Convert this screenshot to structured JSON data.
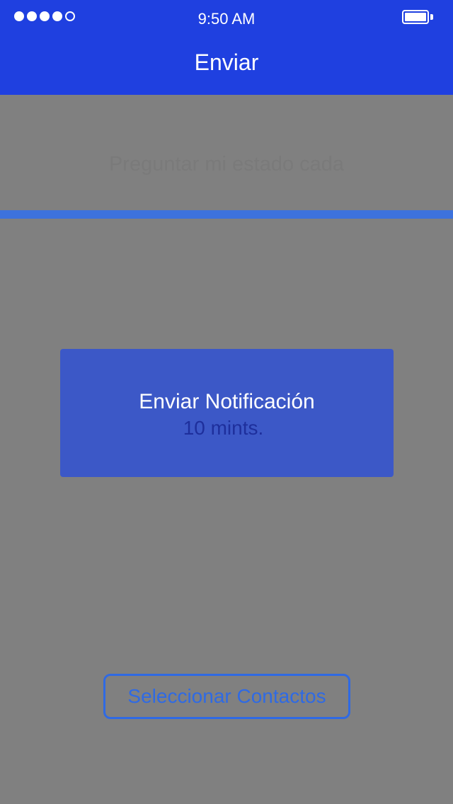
{
  "status_bar": {
    "time": "9:50 AM",
    "signal_icon": "signal-dots-icon",
    "battery_icon": "battery-icon"
  },
  "nav": {
    "title": "Enviar"
  },
  "ask": {
    "label": "Preguntar mi estado cada"
  },
  "dialog": {
    "title": "Enviar Notificación",
    "value": "10 mints."
  },
  "actions": {
    "select_contacts_label": "Seleccionar Contactos"
  },
  "colors": {
    "header_bg": "#1f40e0",
    "overlay_bg": "#808080",
    "dialog_bg": "#3c58c7",
    "accent": "#2f6ae4"
  }
}
